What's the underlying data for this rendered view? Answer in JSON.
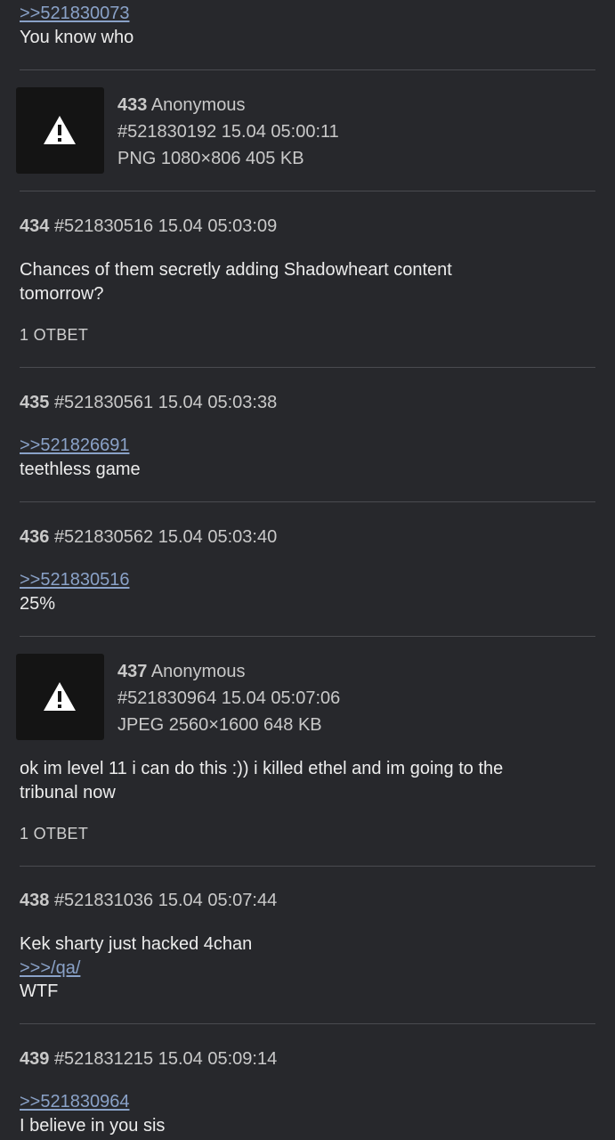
{
  "posts": [
    {
      "quote": ">>521830073",
      "text": "You know who"
    },
    {
      "num": "433",
      "author": "Anonymous",
      "id": "#521830192",
      "date": "15.04",
      "time": "05:00:11",
      "file": "PNG 1080×806 405 KB",
      "thumb_icon": "warning-icon"
    },
    {
      "num": "434",
      "id": "#521830516",
      "date": "15.04",
      "time": "05:03:09",
      "text_line1": "Chances of them secretly adding Shadowheart content",
      "text_line2": "tomorrow?",
      "replies": "1 ОТВЕТ"
    },
    {
      "num": "435",
      "id": "#521830561",
      "date": "15.04",
      "time": "05:03:38",
      "quote": ">>521826691",
      "text": "teethless game"
    },
    {
      "num": "436",
      "id": "#521830562",
      "date": "15.04",
      "time": "05:03:40",
      "quote": ">>521830516",
      "text": "25%"
    },
    {
      "num": "437",
      "author": "Anonymous",
      "id": "#521830964",
      "date": "15.04",
      "time": "05:07:06",
      "file": "JPEG 2560×1600 648 KB",
      "thumb_icon": "warning-icon",
      "text_line1": "ok im level 11 i can do this :)) i killed ethel and im going to the",
      "text_line2": "tribunal now",
      "replies": "1 ОТВЕТ"
    },
    {
      "num": "438",
      "id": "#521831036",
      "date": "15.04",
      "time": "05:07:44",
      "text_line1": "Kek sharty just hacked 4chan",
      "board_link": ">>>/qa/",
      "text_line2": "WTF"
    },
    {
      "num": "439",
      "id": "#521831215",
      "date": "15.04",
      "time": "05:09:14",
      "quote": ">>521830964",
      "text": "I believe in you sis"
    }
  ],
  "colors": {
    "background": "#27282c",
    "link": "#8aa2c8",
    "divider": "#4a4b50",
    "thumb": "#141414"
  }
}
